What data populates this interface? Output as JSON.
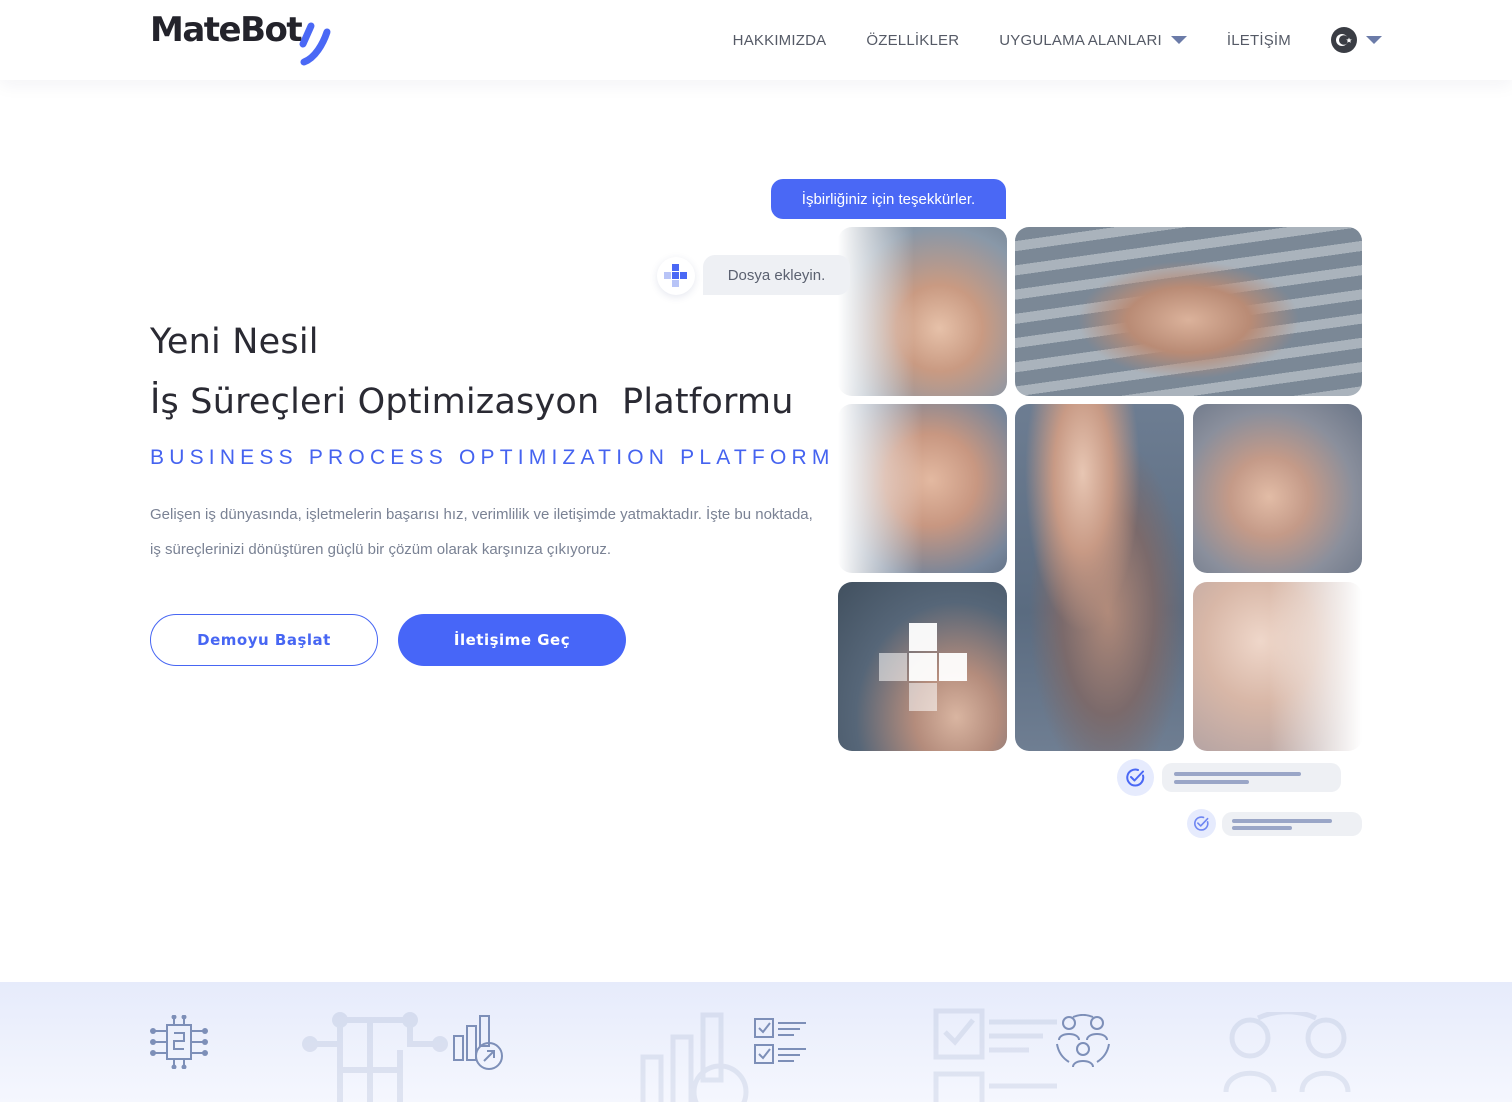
{
  "header": {
    "logo_text": "MateBot",
    "nav": {
      "about": "HAKKIMIZDA",
      "features": "ÖZELLİKLER",
      "use_cases": "UYGULAMA ALANLARI",
      "contact": "İLETİŞİM"
    },
    "language_icon": "turkey-flag-icon"
  },
  "hero": {
    "title_line1": "Yeni Nesil",
    "title_line2": "İş Süreçleri Optimizasyon  Platformu",
    "subtitle": "BUSINESS PROCESS OPTIMIZATION PLATFORM",
    "description": "Gelişen iş dünyasında, işletmelerin başarısı hız, verimlilik ve iletişimde yatmaktadır. İşte bu noktada, iş süreçlerinizi dönüştüren güçlü bir çözüm olarak karşınıza çıkıyoruz.",
    "buttons": {
      "demo": "Demoyu Başlat",
      "contact": "İletişime Geç"
    }
  },
  "collage": {
    "bubble_blue": "İşbirliğiniz için teşekkürler.",
    "bubble_grey": "Dosya ekleyin."
  },
  "features_band": {
    "icons": [
      "circuit-icon",
      "bar-chart-growth-icon",
      "checklist-icon",
      "team-icon"
    ]
  },
  "colors": {
    "accent": "#4766f8",
    "text_dark": "#2a2a33",
    "text_muted": "#7a8294",
    "band_bg": "#e6ebfb"
  }
}
